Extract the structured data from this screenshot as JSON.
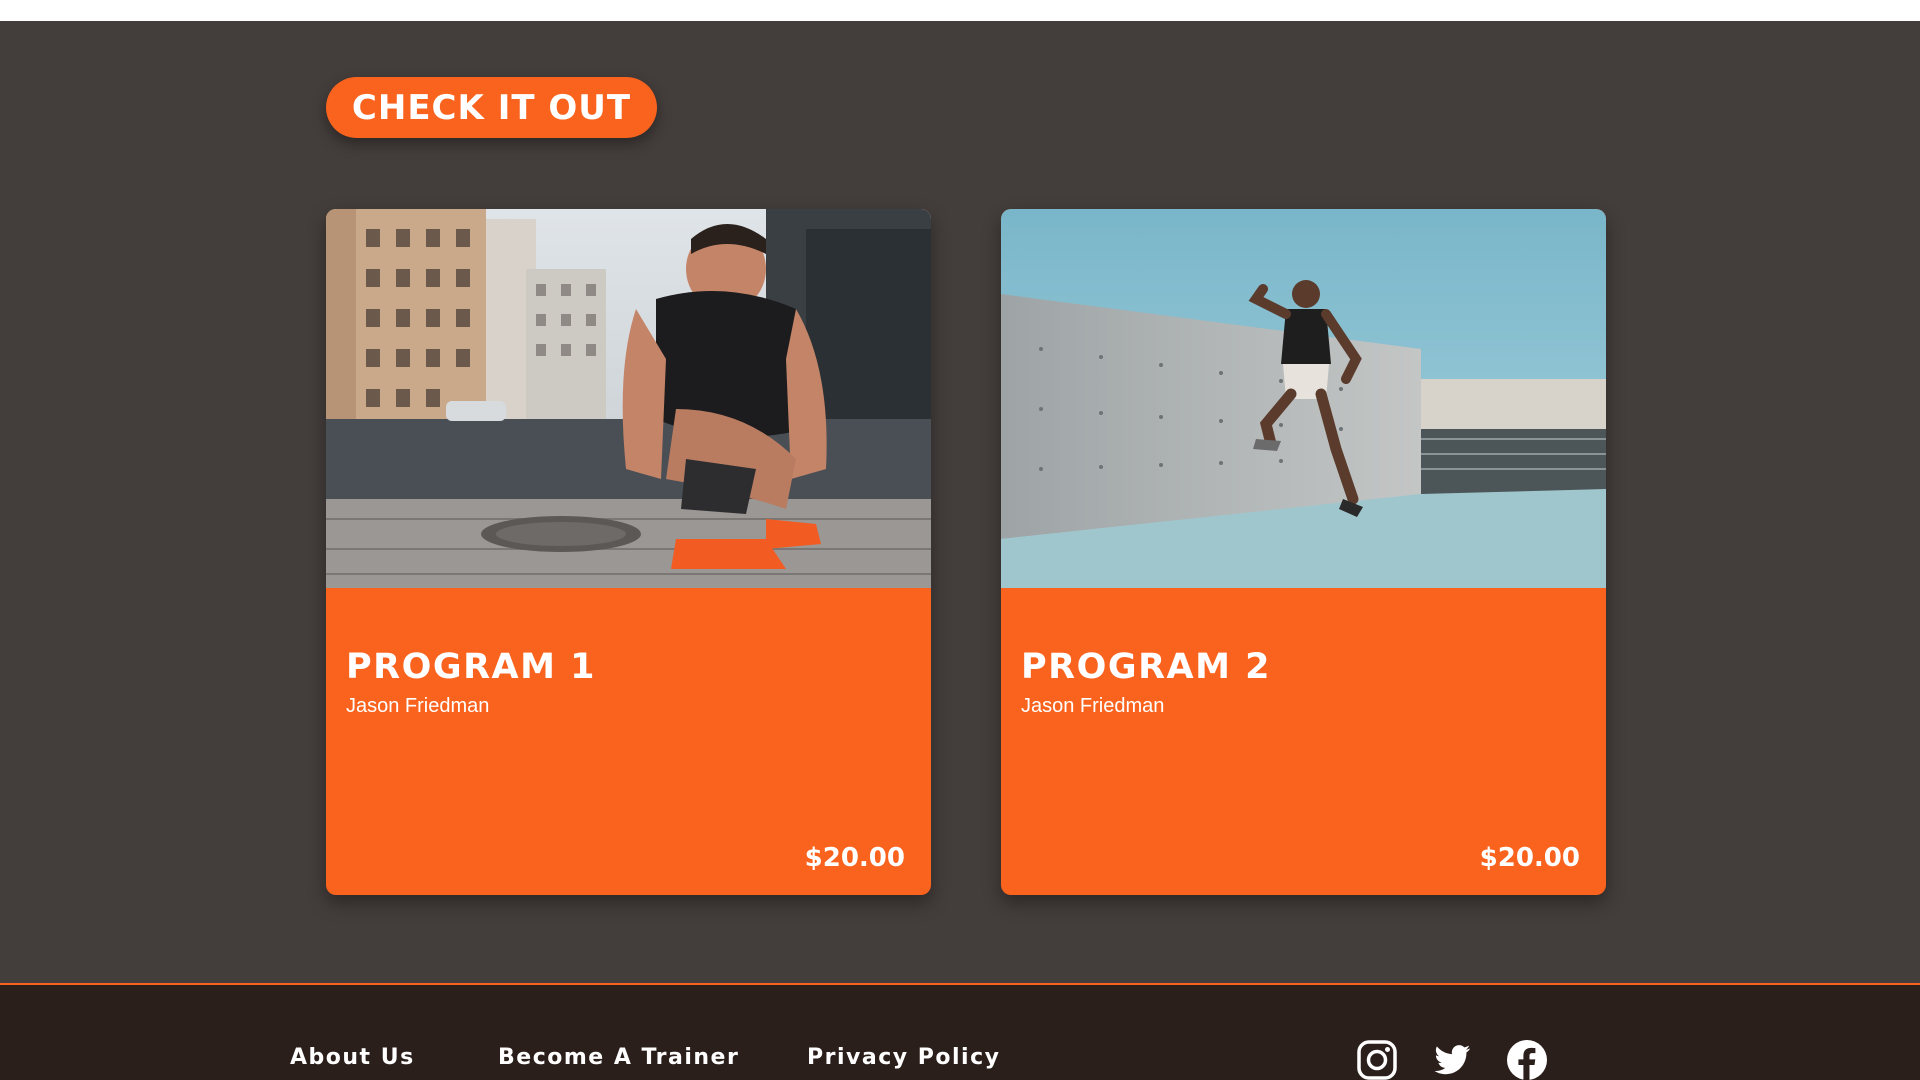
{
  "cta": {
    "label": "CHECK IT OUT"
  },
  "programs": [
    {
      "title": "PROGRAM 1",
      "author": "Jason Friedman",
      "price": "$20.00",
      "image": "runner-tying-shoe-photo"
    },
    {
      "title": "PROGRAM 2",
      "author": "Jason Friedman",
      "price": "$20.00",
      "image": "athlete-jumping-photo"
    }
  ],
  "footer": {
    "links": [
      "About Us",
      "Become A Trainer",
      "Privacy Policy"
    ],
    "social": [
      "instagram-icon",
      "twitter-icon",
      "facebook-icon"
    ]
  },
  "colors": {
    "accent": "#f9631e",
    "background": "#433d3b",
    "footer": "#2b1f1c",
    "text": "#ffffff"
  }
}
